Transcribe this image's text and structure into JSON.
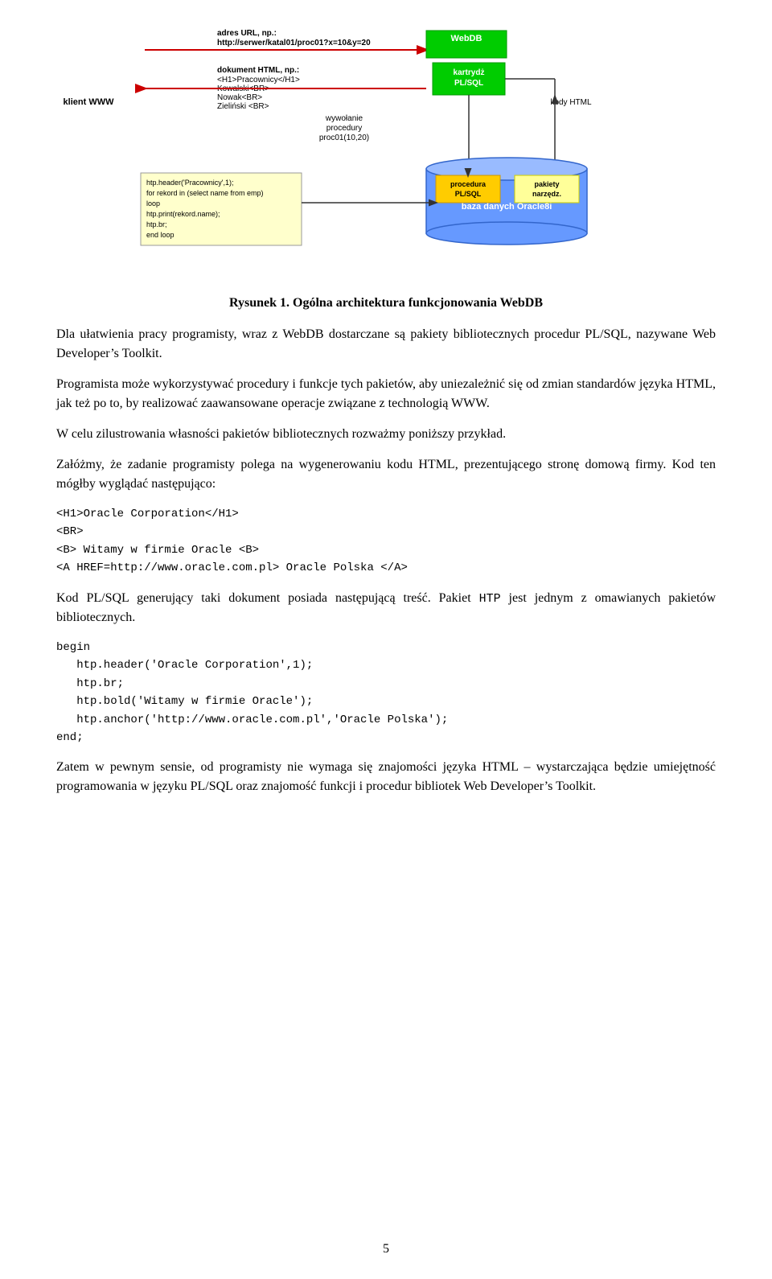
{
  "figure": {
    "caption": "Rysunek 1. Ogólna architektura funkcjonowania WebDB"
  },
  "paragraphs": [
    {
      "id": "p1",
      "text": "Dla ułatwienia pracy programisty, wraz z WebDB dostarczane są pakiety bibliotecznych procedur PL/SQL, nazywane Web Developer’s Toolkit."
    },
    {
      "id": "p2",
      "text": "Programista może wykorzystywać procedury i funkcje tych pakietów, aby uniezależnić się od zmian standardów języka HTML, jak też po to, by realizować zaawansowane operacje związane z technologią WWW."
    },
    {
      "id": "p3",
      "text": "W celu zilustrowania własności pakietów bibliotecznych rozważmy poniższy przykład."
    },
    {
      "id": "p4",
      "text": "Załóżmy, że zadanie programisty polega na wygenerowaniu kodu HTML, prezentującego stronę domową firmy. Kod ten mógłby wyglądać następująco:"
    }
  ],
  "code_block_1": {
    "lines": [
      "<H1>Oracle Corporation</H1>",
      "<BR>",
      "<B> Witamy w firmie Oracle <B>",
      "<A HREF=http://www.oracle.com.pl> Oracle Polska </A>"
    ]
  },
  "paragraph_mid": {
    "text": "Kod PL/SQL generujący taki dokument posiada następującą treść. Pakiet "
  },
  "inline_code_htp": "HTP",
  "paragraph_mid_cont": " jest jednym z omawianych pakietów bibliotecznych.",
  "code_block_2": {
    "lines": [
      "begin",
      "   htp.header('Oracle Corporation',1);",
      "   htp.br;",
      "   htp.bold('Witamy w firmie Oracle');",
      "   htp.anchor('http://www.oracle.com.pl','Oracle Polska');",
      "end;"
    ]
  },
  "paragraph_last": {
    "text": "Zatem w pewnym sensie, od programisty nie wymaga się znajomości języka HTML – wystarczająca będzie umiejętność programowania w języku PL/SQL oraz znajomość funkcji i procedur bibliotek Web Developer’s Toolkit."
  },
  "page_number": "5",
  "diagram": {
    "klient_label": "klient WWW",
    "webdb_label": "WebDB",
    "kartrydz_label": "kartrydż\nPL/SQL",
    "wywolanie_label": "wywołanie\nprocedury\nproc01(10,20)",
    "kody_html_label": "kody HTML",
    "procedura_label": "procedura\nPL/SQL",
    "pakiety_label": "pakiety\nnarzędz.",
    "baza_label": "baza danych Oracle8i",
    "url_label": "adres URL, np.:",
    "url_value": "http://serwer/katal01/proc01?x=10&y=20",
    "dokument_label": "dokument HTML, np.:",
    "html_lines": [
      "<H1>Pracownicy</H1>",
      "Kowalski<BR>",
      "Nowak<BR>",
      "Zieliński <BR>"
    ],
    "htp_code": "htp.header('Pracownicy',1);\nfor rekord in (select name from emp)\nloop\nhtp.print(rekord.name);\nhtp.br;\nend loop"
  }
}
